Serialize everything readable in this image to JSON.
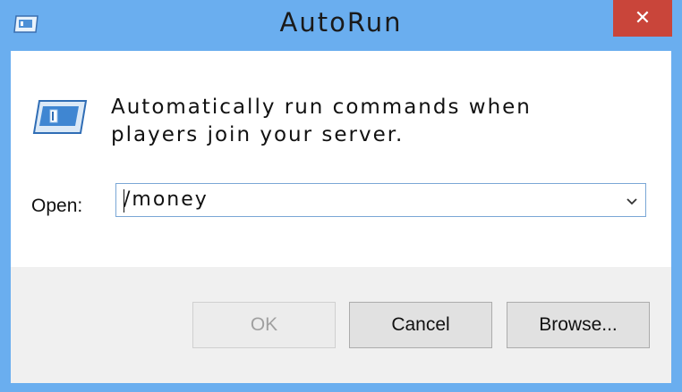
{
  "window": {
    "title": "AutoRun",
    "close_label": "✕"
  },
  "content": {
    "description_line1": "Automatically run commands when",
    "description_line2": "players join your server.",
    "open_label": "Open:",
    "open_value": "/money"
  },
  "buttons": {
    "ok": "OK",
    "cancel": "Cancel",
    "browse": "Browse..."
  },
  "colors": {
    "frame": "#6aaeef",
    "close": "#c9453a"
  }
}
